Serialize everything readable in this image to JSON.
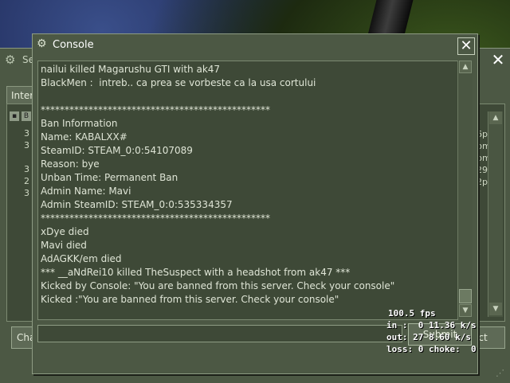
{
  "background_window": {
    "title": "Se",
    "tab": "Interne",
    "list_numbers": [
      "3",
      "3",
      "3",
      "2",
      "3"
    ],
    "list_times": [
      "6pm",
      "pm",
      "pm",
      "29p",
      "2pm"
    ],
    "bottom_left_button": "Cha",
    "bottom_right_button": "ect"
  },
  "console": {
    "title": "Console",
    "log": [
      "nailui killed Magarushu GTI with ak47",
      "BlackMen :  intreb.. ca prea se vorbeste ca la usa cortului",
      "",
      "************************************************",
      "Ban Information",
      "Name: KABALXX#",
      "SteamID: STEAM_0:0:54107089",
      "Reason: bye",
      "Unban Time: Permanent Ban",
      "Admin Name: Mavi",
      "Admin SteamID: STEAM_0:0:535334357",
      "************************************************",
      "xDye died",
      "Mavi died",
      "AdAGKK/em died",
      "*** __aNdRei10 killed TheSuspect with a headshot from ak47 ***",
      "Kicked by Console: \"You are banned from this server. Check your console\"",
      "Kicked :\"You are banned from this server. Check your console\""
    ],
    "input_value": "",
    "submit_label": "Submit"
  },
  "net_graph": {
    "fps": "100.5 fps",
    "in": "in :  0 11.36 k/s",
    "out": "out: 27 8.60 k/s",
    "loss": "loss: 0 choke:  0"
  },
  "icons": {
    "steam": "steam-icon",
    "close": "close-icon"
  },
  "colors": {
    "window_bg": "#4c5844",
    "log_bg": "#3e4937",
    "text": "#dfe5d6"
  }
}
